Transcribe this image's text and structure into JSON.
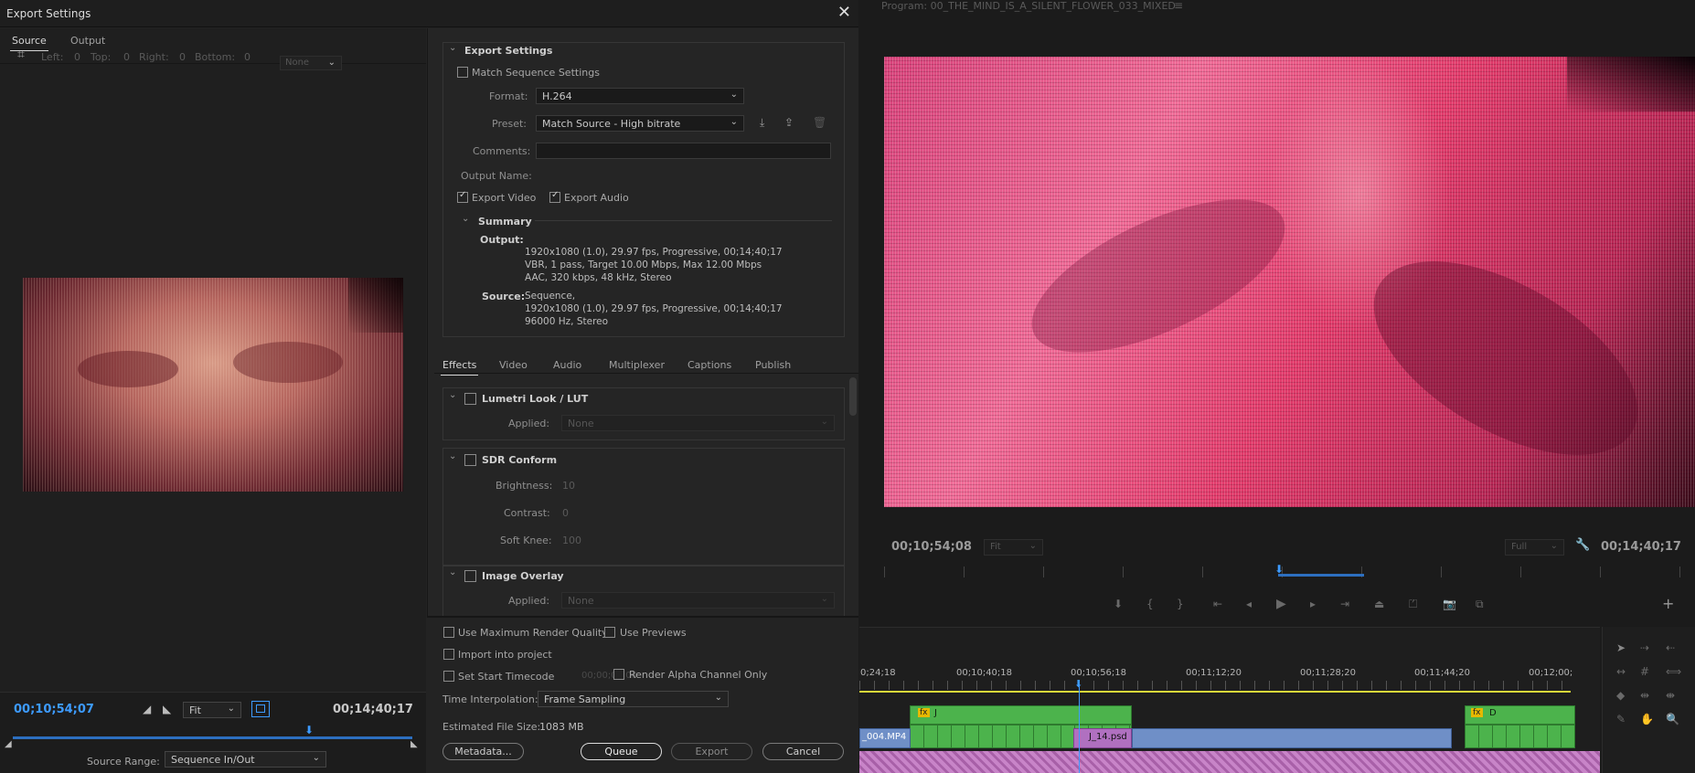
{
  "dialog": {
    "title": "Export Settings",
    "tabs": [
      "Source",
      "Output"
    ],
    "crop": {
      "left_label": "Left:",
      "left": "0",
      "top_label": "Top:",
      "top": "0",
      "right_label": "Right:",
      "right": "0",
      "bottom_label": "Bottom:",
      "bottom": "0",
      "aspect": "None"
    },
    "preview": {
      "current_tc": "00;10;54;07",
      "zoom": "Fit",
      "end_tc": "00;14;40;17",
      "playhead_fraction": 0.75
    },
    "source_range": {
      "label": "Source Range:",
      "value": "Sequence In/Out"
    }
  },
  "export_settings": {
    "header": "Export Settings",
    "match_sequence": "Match Sequence Settings",
    "format_label": "Format:",
    "format": "H.264",
    "preset_label": "Preset:",
    "preset": "Match Source - High bitrate",
    "comments_label": "Comments:",
    "output_name_label": "Output Name:",
    "export_video": "Export Video",
    "export_audio": "Export Audio",
    "summary": {
      "header": "Summary",
      "output_label": "Output:",
      "output_lines": [
        "1920x1080 (1.0), 29.97 fps, Progressive, 00;14;40;17",
        "VBR, 1 pass, Target 10.00 Mbps, Max 12.00 Mbps",
        "AAC, 320 kbps, 48 kHz, Stereo"
      ],
      "source_label": "Source:",
      "source_lines": [
        "Sequence,",
        "1920x1080 (1.0), 29.97 fps, Progressive, 00;14;40;17",
        "96000 Hz, Stereo"
      ]
    }
  },
  "settings_tabs": [
    "Effects",
    "Video",
    "Audio",
    "Multiplexer",
    "Captions",
    "Publish"
  ],
  "effects": {
    "lumetri": {
      "title": "Lumetri Look / LUT",
      "applied_label": "Applied:",
      "applied": "None"
    },
    "sdr": {
      "title": "SDR Conform",
      "brightness_label": "Brightness:",
      "brightness": "10",
      "contrast_label": "Contrast:",
      "contrast": "0",
      "softknee_label": "Soft Knee:",
      "softknee": "100"
    },
    "overlay": {
      "title": "Image Overlay",
      "applied_label": "Applied:",
      "applied": "None"
    }
  },
  "bottom_options": {
    "max_render": "Use Maximum Render Quality",
    "use_previews": "Use Previews",
    "import_project": "Import into project",
    "set_start_tc": "Set Start Timecode",
    "start_tc_value": "00;00;00;00",
    "render_alpha": "Render Alpha Channel Only",
    "time_interp_label": "Time Interpolation:",
    "time_interp": "Frame Sampling",
    "file_size_label": "Estimated File Size:",
    "file_size": "1083 MB"
  },
  "buttons": {
    "metadata": "Metadata...",
    "queue": "Queue",
    "export": "Export",
    "cancel": "Cancel"
  },
  "program": {
    "title": "Program: 00_THE_MIND_IS_A_SILENT_FLOWER_033_MIXED",
    "current_tc": "00;10;54;08",
    "zoom": "Fit",
    "quality": "Full",
    "end_tc": "00;14;40;17",
    "playhead_fraction": 0.56
  },
  "timeline": {
    "ruler": [
      "0;24;18",
      "00;10;40;18",
      "00;10;56;18",
      "00;11;12;20",
      "00;11;28;20",
      "00;11;44;20",
      "00;12;00;"
    ],
    "clips": {
      "mp4": "_004.MP4",
      "j_label": "J",
      "psd": "J_14.psd",
      "d_label": "D",
      "fx": "fx"
    }
  },
  "colors": {
    "accent": "#3d9bff",
    "clip_green": "#4cb34c",
    "clip_blue": "#6f8fc7",
    "audio_pink": "#d9a0d9"
  }
}
